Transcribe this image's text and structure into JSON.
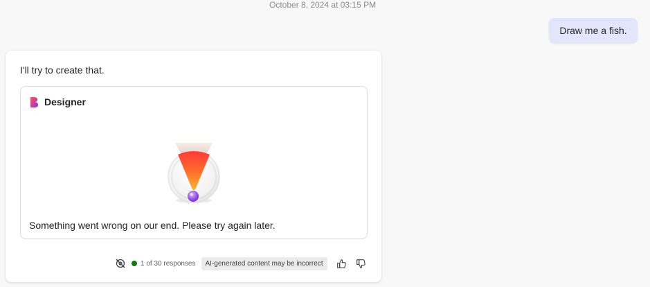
{
  "conversation": {
    "timestamp": "October 8, 2024 at 03:15 PM",
    "user_message": "Draw me a fish.",
    "assistant": {
      "intro": "I'll try to create that.",
      "designer": {
        "title": "Designer",
        "logo_icon": "designer-logo-icon",
        "illustration": "error-exclamation-illustration",
        "error_message": "Something went wrong on our end. Please try again later."
      },
      "footer": {
        "sensitivity_icon": "no-sensitivity-icon",
        "response_count": "1 of 30 responses",
        "status_color": "#107c10",
        "ai_disclaimer": "AI-generated content may be incorrect",
        "thumbs_up_icon": "thumbs-up-icon",
        "thumbs_down_icon": "thumbs-down-icon"
      }
    }
  },
  "colors": {
    "background": "#f8f8f8",
    "user_bubble": "#e3e6fb",
    "card": "#ffffff",
    "status_green": "#107c10"
  }
}
